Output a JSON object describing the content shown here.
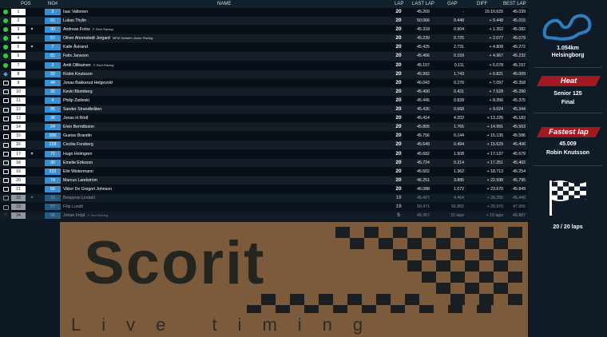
{
  "header": {
    "pos": "POS",
    "no": "NO#",
    "name": "NAME",
    "lap": "LAP",
    "last_lap": "LAST LAP",
    "gap": "GAP",
    "diff": "DIFF",
    "best_lap": "BEST LAP"
  },
  "rows": [
    {
      "status": "green",
      "pos": "1",
      "chg": "",
      "no": "3",
      "name": "Isac Valtonen",
      "team": "",
      "lap": "20",
      "last": "45.269",
      "gap": "-",
      "diff": "15:10.625",
      "best": "45.039"
    },
    {
      "status": "green",
      "pos": "2",
      "chg": "",
      "no": "61",
      "name": "Lukas Thylin",
      "team": "",
      "lap": "20",
      "last": "50.066",
      "gap": "0.448",
      "diff": "+ 0.448",
      "best": "45.015"
    },
    {
      "status": "green",
      "pos": "3",
      "chg": "▾",
      "no": "90",
      "name": "Andreas Forss",
      "team": "F-Tech Racing",
      "lap": "20",
      "last": "45.318",
      "gap": "0.904",
      "diff": "+ 1.352",
      "best": "45.082"
    },
    {
      "status": "green",
      "pos": "4",
      "chg": "",
      "no": "57",
      "name": "Oliver Ahrenstedt Jergard",
      "team": "MPM Sweden Junior Racing",
      "lap": "20",
      "last": "45.239",
      "gap": "0.725",
      "diff": "+ 2.077",
      "best": "45.079"
    },
    {
      "status": "green",
      "pos": "5",
      "chg": "▾",
      "no": "7",
      "name": "Kalle Åstrand",
      "team": "",
      "lap": "20",
      "last": "45.425",
      "gap": "2.731",
      "diff": "+ 4.808",
      "best": "45.272"
    },
    {
      "status": "green",
      "pos": "6",
      "chg": "",
      "no": "81",
      "name": "Felix Jansson",
      "team": "",
      "lap": "20",
      "last": "45.466",
      "gap": "0.159",
      "diff": "+ 4.967",
      "best": "45.232"
    },
    {
      "status": "green",
      "pos": "7",
      "chg": "",
      "no": "2",
      "name": "Antti Ollikainen",
      "team": "F-Tech Racing",
      "lap": "20",
      "last": "45.157",
      "gap": "0.111",
      "diff": "+ 5.078",
      "best": "45.157"
    },
    {
      "status": "diamond",
      "pos": "8",
      "chg": "",
      "no": "32",
      "name": "Robin Knutsson",
      "team": "",
      "lap": "20",
      "last": "45.992",
      "gap": "1.743",
      "diff": "+ 6.821",
      "best": "45.009"
    },
    {
      "status": "flag",
      "pos": "9",
      "chg": "",
      "no": "44",
      "name": "Jonas Bakkerud Helgevold",
      "team": "",
      "lap": "20",
      "last": "46.043",
      "gap": "0.276",
      "diff": "+ 7.097",
      "best": "45.358"
    },
    {
      "status": "flag",
      "pos": "10",
      "chg": "",
      "no": "26",
      "name": "Kevin Blomberg",
      "team": "",
      "lap": "20",
      "last": "45.400",
      "gap": "0.431",
      "diff": "+ 7.528",
      "best": "45.290"
    },
    {
      "status": "flag",
      "pos": "11",
      "chg": "",
      "no": "4",
      "name": "Philip Zielinski",
      "team": "",
      "lap": "20",
      "last": "45.445",
      "gap": "0.828",
      "diff": "+ 8.356",
      "best": "45.375"
    },
    {
      "status": "flag",
      "pos": "12",
      "chg": "",
      "no": "95",
      "name": "Sander Strandbråten",
      "team": "",
      "lap": "20",
      "last": "45.430",
      "gap": "0.668",
      "diff": "+ 9.024",
      "best": "45.344"
    },
    {
      "status": "flag",
      "pos": "13",
      "chg": "",
      "no": "36",
      "name": "Jonas H Rödl",
      "team": "",
      "lap": "20",
      "last": "45.414",
      "gap": "4.202",
      "diff": "+ 13.226",
      "best": "45.183"
    },
    {
      "status": "flag",
      "pos": "14",
      "chg": "",
      "no": "24",
      "name": "Elvin Berndtsson",
      "team": "",
      "lap": "20",
      "last": "45.805",
      "gap": "1.765",
      "diff": "+ 14.991",
      "best": "45.563"
    },
    {
      "status": "flag",
      "pos": "15",
      "chg": "",
      "no": "306",
      "name": "Gustav Brandin",
      "team": "",
      "lap": "20",
      "last": "45.756",
      "gap": "0.144",
      "diff": "+ 15.135",
      "best": "45.586"
    },
    {
      "status": "flag",
      "pos": "16",
      "chg": "",
      "no": "228",
      "name": "Cecilia Forsberg",
      "team": "",
      "lap": "20",
      "last": "45.649",
      "gap": "0.494",
      "diff": "+ 15.629",
      "best": "45.406"
    },
    {
      "status": "flag",
      "pos": "17",
      "chg": "▾",
      "no": "72",
      "name": "Hugo Holmgren",
      "team": "",
      "lap": "20",
      "last": "45.682",
      "gap": "1.508",
      "diff": "+ 17.137",
      "best": "45.679"
    },
    {
      "status": "flag",
      "pos": "18",
      "chg": "",
      "no": "30",
      "name": "Emelie Eriksson",
      "team": "",
      "lap": "20",
      "last": "45.724",
      "gap": "0.214",
      "diff": "+ 17.351",
      "best": "45.402"
    },
    {
      "status": "flag",
      "pos": "19",
      "chg": "",
      "no": "232",
      "name": "Elin Wistermann",
      "team": "",
      "lap": "20",
      "last": "45.502",
      "gap": "1.362",
      "diff": "+ 18.713",
      "best": "45.254"
    },
    {
      "status": "flag",
      "pos": "20",
      "chg": "",
      "no": "74",
      "name": "Marcus Landström",
      "team": "",
      "lap": "20",
      "last": "46.251",
      "gap": "3.885",
      "diff": "+ 22.598",
      "best": "45.795"
    },
    {
      "status": "flag",
      "pos": "21",
      "chg": "",
      "no": "66",
      "name": "Viktor De Gregori Johnson",
      "team": "",
      "lap": "20",
      "last": "46.088",
      "gap": "1.072",
      "diff": "+ 23.670",
      "best": "45.849"
    },
    {
      "status": "flag",
      "pos": "22",
      "chg": "▾",
      "no": "15",
      "name": "Benjamin Lindahl",
      "team": "",
      "lap": "19",
      "last": "45.497",
      "gap": "4.464",
      "diff": "+ 28.255",
      "best": "45.440",
      "faded": true
    },
    {
      "status": "flag",
      "pos": "23",
      "chg": "",
      "no": "37",
      "name": "Filip Lundh",
      "team": "",
      "lap": "19",
      "last": "50.471",
      "gap": "56.855",
      "diff": "+ 29.970",
      "best": "47.955",
      "faded": true
    },
    {
      "status": "x",
      "pos": "24",
      "chg": "",
      "no": "96",
      "name": "Johan Fröjd",
      "team": "F-Tech Racing",
      "lap": "5",
      "last": "45.357",
      "gap": "15 laps",
      "diff": "+ 15 laps",
      "best": "45.887",
      "faded": true
    }
  ],
  "sidebar": {
    "track_length": "1.054km",
    "track_name": "Helsingborg",
    "heat_label": "Heat",
    "heat_class": "Senior 125",
    "heat_name": "Final",
    "fastest_label": "Fastest lap",
    "fastest_time": "45.009",
    "fastest_driver": "Robin Knutsson",
    "laps": "20 / 20 laps"
  },
  "logo": {
    "title": "Scorit",
    "subtitle": "Live timing"
  },
  "colors": {
    "number_bg": "#3a8fd0",
    "banner_red": "#a11a21",
    "logo_brown": "#7c5a3c",
    "status_green": "#2ecc40"
  },
  "icons": [
    "track-map-icon",
    "checkered-flag-icon",
    "status-flag-icon"
  ]
}
